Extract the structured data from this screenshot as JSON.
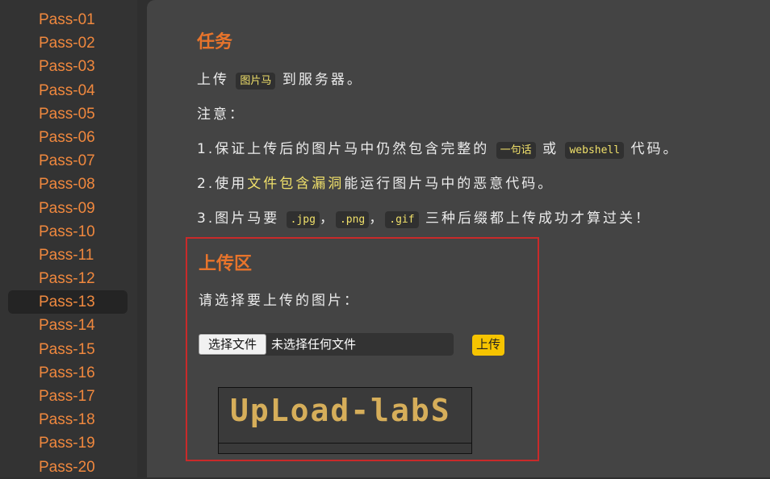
{
  "sidebar": {
    "items": [
      "Pass-01",
      "Pass-02",
      "Pass-03",
      "Pass-04",
      "Pass-05",
      "Pass-06",
      "Pass-07",
      "Pass-08",
      "Pass-09",
      "Pass-10",
      "Pass-11",
      "Pass-12",
      "Pass-13",
      "Pass-14",
      "Pass-15",
      "Pass-16",
      "Pass-17",
      "Pass-18",
      "Pass-19",
      "Pass-20"
    ],
    "active_index": 12
  },
  "task": {
    "title": "任务",
    "line1": {
      "pre": "上传",
      "code": "图片马",
      "post": "到服务器。"
    },
    "line2": "注意：",
    "line3": {
      "pre": "1.保证上传后的图片马中仍然包含完整的",
      "code1": "一句话",
      "mid": "或",
      "code2": "webshell",
      "post": "代码。"
    },
    "line4": {
      "pre": "2.使用",
      "highlight": "文件包含漏洞",
      "post": "能运行图片马中的恶意代码。"
    },
    "line5": {
      "pre": "3.图片马要",
      "code1": ".jpg",
      "sep1": "，",
      "code2": ".png",
      "sep2": "，",
      "code3": ".gif",
      "post": "三种后缀都上传成功才算过关！"
    }
  },
  "upload": {
    "title": "上传区",
    "prompt": "请选择要上传的图片：",
    "file_button": "选择文件",
    "file_status": "未选择任何文件",
    "submit": "上传",
    "logo_text": "UpLoad-labS"
  },
  "colors": {
    "accent": "#e8742b",
    "highlight": "#f0e06a",
    "upload_border": "#c92a2a",
    "submit_bg": "#f6c400"
  }
}
